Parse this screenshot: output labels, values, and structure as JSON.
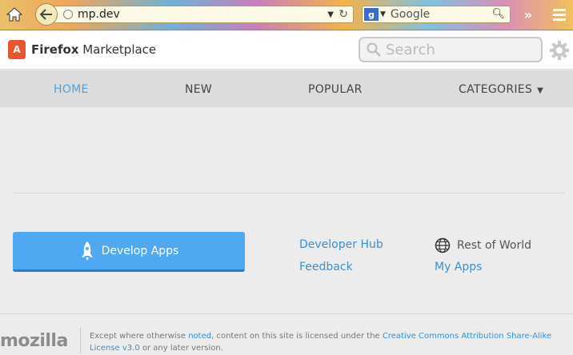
{
  "browser": {
    "url": "mp.dev",
    "search_engine_placeholder": "Google"
  },
  "site": {
    "logo_text_bold": "Firefox",
    "logo_text_rest": " Marketplace",
    "search_placeholder": "Search"
  },
  "nav": {
    "items": [
      {
        "label": "HOME"
      },
      {
        "label": "NEW"
      },
      {
        "label": "POPULAR"
      },
      {
        "label": "CATEGORIES"
      }
    ]
  },
  "main": {
    "develop_button": "Develop Apps",
    "links": {
      "developer_hub": "Developer Hub",
      "feedback": "Feedback",
      "region": "Rest of World",
      "my_apps": "My Apps"
    }
  },
  "footer": {
    "brand": "mozilla",
    "legal_1": "Except where otherwise ",
    "legal_link_1": "noted",
    "legal_2": ", content on this site is licensed under the ",
    "legal_link_2": "Creative Commons Attribution Share-Alike License v3.0",
    "legal_3": " or any later version."
  },
  "colors": {
    "accent": "#4ea3e0",
    "button": "#4fa9f2",
    "logo": "#e9552e"
  }
}
